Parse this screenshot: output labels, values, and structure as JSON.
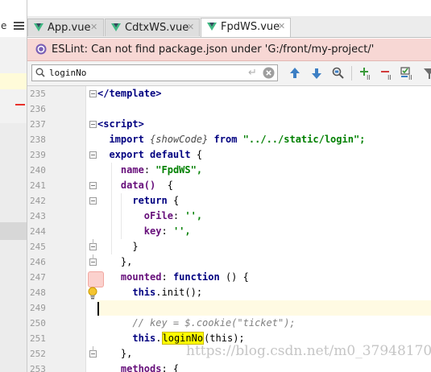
{
  "left_pane": {
    "tab_fragment": "e"
  },
  "tabs": [
    {
      "label": "App.vue",
      "close": "✕",
      "active": false
    },
    {
      "label": "CdtxWS.vue",
      "close": "✕",
      "active": false
    },
    {
      "label": "FpdWS.vue",
      "close": "✕",
      "active": true
    }
  ],
  "notification": {
    "text": "ESLint: Can not find package.json under 'G:/front/my-project/'"
  },
  "search": {
    "value": "loginNo",
    "enter_glyph": "↵"
  },
  "gutter": {
    "lines": [
      "235",
      "236",
      "237",
      "238",
      "239",
      "240",
      "241",
      "242",
      "243",
      "244",
      "245",
      "246",
      "247",
      "248",
      "249",
      "250",
      "251",
      "252",
      "253"
    ]
  },
  "code": {
    "l235": "</template>",
    "l237": "<script>",
    "l238_kw": "import",
    "l238_name": "{showCode}",
    "l238_from": "from",
    "l238_str": "\"../../static/login\";",
    "l239_kw": "export default",
    "l239_rest": " {",
    "l240_prop": "name",
    "l240_str": "\"FpdWS\",",
    "l241_prop": "data()",
    "l241_rest": "  {",
    "l242_kw": "return",
    "l242_rest": " {",
    "l243_prop": "oFile",
    "l243_str": "'',",
    "l244_prop": "key",
    "l244_str": "'',",
    "l245": "}",
    "l246": "},",
    "l247_prop": "mounted",
    "l247_kw": "function",
    "l247_rest": " () {",
    "l248_kw": "this",
    "l248_rest": ".init();",
    "l250": "// key = $.cookie(\"ticket\");",
    "l251_kw": "this",
    "l251_hl": "loginNo",
    "l251_rest": "(this);",
    "l252": "},",
    "l253_prop": "methods",
    "l253_rest": ": {"
  },
  "watermark": "https://blog.csdn.net/m0_37948170",
  "colors": {
    "notification_bg": "#f7d7d4",
    "highlight": "#ffff00",
    "current_line": "#fffae3",
    "vue_green": "#41b883"
  }
}
